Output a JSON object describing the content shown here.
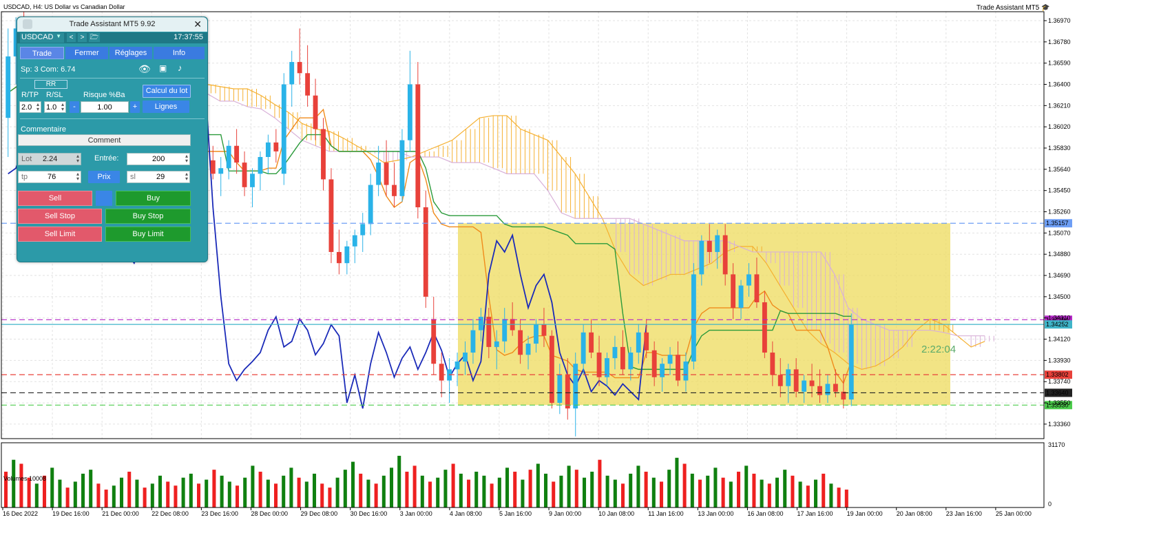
{
  "chart": {
    "header": "USDCAD, H4:  US Dollar vs Canadian Dollar",
    "watermark": "Trade Assistant MT5",
    "volume_label": "Volumes 10008",
    "countdown": "2:22:04",
    "colors": {
      "bull": "#2ab3e8",
      "bear": "#e8413a",
      "kijun": "#2a9a3a",
      "tenkan": "#f08a1a",
      "chikou": "#1a2ab8",
      "kumo_up": "#f5b030",
      "kumo_down": "#d8b0d8",
      "zone": "#eedb5c",
      "vol_up": "#108010",
      "vol_down": "#ee2020"
    }
  },
  "chart_data": {
    "type": "candlestick",
    "symbol": "USDCAD",
    "timeframe": "H4",
    "ylim": [
      1.3323,
      1.3705
    ],
    "y_ticks": [
      "1.36970",
      "1.36780",
      "1.36590",
      "1.36400",
      "1.36210",
      "1.36020",
      "1.35830",
      "1.35640",
      "1.35450",
      "1.35260",
      "1.35070",
      "1.34880",
      "1.34690",
      "1.34500",
      "1.34310",
      "1.34120",
      "1.33930",
      "1.33740",
      "1.33550",
      "1.33360"
    ],
    "x_ticks": [
      "16 Dec 2022",
      "19 Dec 16:00",
      "21 Dec 00:00",
      "22 Dec 08:00",
      "23 Dec 16:00",
      "28 Dec 00:00",
      "29 Dec 08:00",
      "30 Dec 16:00",
      "3 Jan 00:00",
      "4 Jan 08:00",
      "5 Jan 16:00",
      "9 Jan 00:00",
      "10 Jan 08:00",
      "11 Jan 16:00",
      "13 Jan 00:00",
      "16 Jan 08:00",
      "17 Jan 16:00",
      "19 Jan 00:00",
      "20 Jan 08:00",
      "23 Jan 16:00",
      "25 Jan 00:00"
    ],
    "price_levels": [
      {
        "label": "1.35157",
        "value": 1.35157,
        "color": "#6d9ef5"
      },
      {
        "label": "1.34294",
        "value": 1.34294,
        "color": "#b427c8"
      },
      {
        "label": "1.34252",
        "value": 1.34252,
        "color": "#3fb4c8"
      },
      {
        "label": "1.33802",
        "value": 1.33802,
        "color": "#e8413a"
      },
      {
        "label": "1.33640",
        "value": 1.3364,
        "color": "#222222"
      },
      {
        "label": "1.33530",
        "value": 1.3353,
        "color": "#4ccc4c"
      }
    ],
    "volume_axis": [
      "31170",
      "0"
    ],
    "candles": [
      [
        1.361,
        1.369,
        1.3575,
        1.3665
      ],
      [
        1.3665,
        1.37,
        1.364,
        1.369
      ],
      [
        1.369,
        1.3705,
        1.3655,
        1.3668
      ],
      [
        1.3585,
        1.36,
        1.353,
        1.3545
      ],
      [
        1.3545,
        1.3575,
        1.352,
        1.356
      ],
      [
        1.356,
        1.359,
        1.3545,
        1.358
      ],
      [
        1.358,
        1.363,
        1.357,
        1.3615
      ],
      [
        1.3615,
        1.364,
        1.3595,
        1.3605
      ],
      [
        1.3605,
        1.3615,
        1.356,
        1.357
      ],
      [
        1.357,
        1.36,
        1.356,
        1.359
      ],
      [
        1.359,
        1.361,
        1.3575,
        1.358
      ],
      [
        1.352,
        1.354,
        1.349,
        1.35
      ],
      [
        1.35,
        1.3535,
        1.3485,
        1.3525
      ],
      [
        1.3525,
        1.358,
        1.3515,
        1.357
      ],
      [
        1.357,
        1.3585,
        1.353,
        1.354
      ],
      [
        1.354,
        1.3555,
        1.35,
        1.351
      ],
      [
        1.351,
        1.3545,
        1.35,
        1.3535
      ],
      [
        1.3535,
        1.36,
        1.353,
        1.359
      ],
      [
        1.359,
        1.361,
        1.3575,
        1.36
      ],
      [
        1.36,
        1.363,
        1.359,
        1.3622
      ],
      [
        1.3622,
        1.3635,
        1.3595,
        1.3605
      ],
      [
        1.3605,
        1.3615,
        1.358,
        1.3585
      ],
      [
        1.3585,
        1.36,
        1.356,
        1.357
      ],
      [
        1.357,
        1.358,
        1.3535,
        1.3545
      ],
      [
        1.3545,
        1.3565,
        1.3525,
        1.3555
      ],
      [
        1.3555,
        1.358,
        1.3545,
        1.3572
      ],
      [
        1.3572,
        1.3585,
        1.3555,
        1.356
      ],
      [
        1.356,
        1.3575,
        1.354,
        1.3565
      ],
      [
        1.3565,
        1.359,
        1.3555,
        1.3585
      ],
      [
        1.3585,
        1.36,
        1.356,
        1.357
      ],
      [
        1.357,
        1.358,
        1.354,
        1.3548
      ],
      [
        1.3548,
        1.3565,
        1.353,
        1.356
      ],
      [
        1.356,
        1.358,
        1.3545,
        1.3575
      ],
      [
        1.3575,
        1.3595,
        1.356,
        1.3588
      ],
      [
        1.3588,
        1.36,
        1.357,
        1.358
      ],
      [
        1.356,
        1.365,
        1.355,
        1.364
      ],
      [
        1.364,
        1.367,
        1.362,
        1.366
      ],
      [
        1.366,
        1.369,
        1.364,
        1.365
      ],
      [
        1.365,
        1.3675,
        1.362,
        1.363
      ],
      [
        1.363,
        1.3645,
        1.359,
        1.36
      ],
      [
        1.36,
        1.361,
        1.3545,
        1.3555
      ],
      [
        1.3555,
        1.3565,
        1.348,
        1.349
      ],
      [
        1.349,
        1.351,
        1.347,
        1.348
      ],
      [
        1.348,
        1.35,
        1.347,
        1.3495
      ],
      [
        1.3495,
        1.351,
        1.348,
        1.3505
      ],
      [
        1.3505,
        1.3525,
        1.349,
        1.3515
      ],
      [
        1.3515,
        1.356,
        1.3505,
        1.355
      ],
      [
        1.355,
        1.3585,
        1.354,
        1.357
      ],
      [
        1.357,
        1.359,
        1.354,
        1.355
      ],
      [
        1.355,
        1.357,
        1.353,
        1.354
      ],
      [
        1.354,
        1.36,
        1.3535,
        1.359
      ],
      [
        1.359,
        1.367,
        1.358,
        1.364
      ],
      [
        1.364,
        1.366,
        1.352,
        1.353
      ],
      [
        1.353,
        1.3545,
        1.344,
        1.345
      ],
      [
        1.343,
        1.345,
        1.338,
        1.339
      ],
      [
        1.339,
        1.34,
        1.336,
        1.3375
      ],
      [
        1.3375,
        1.3395,
        1.3355,
        1.3385
      ],
      [
        1.3385,
        1.34,
        1.337,
        1.3392
      ],
      [
        1.3392,
        1.341,
        1.338,
        1.34
      ],
      [
        1.34,
        1.343,
        1.339,
        1.342
      ],
      [
        1.342,
        1.344,
        1.341,
        1.3432
      ],
      [
        1.3432,
        1.344,
        1.3395,
        1.3405
      ],
      [
        1.3405,
        1.342,
        1.3385,
        1.341
      ],
      [
        1.341,
        1.344,
        1.34,
        1.343
      ],
      [
        1.343,
        1.3445,
        1.3415,
        1.342
      ],
      [
        1.342,
        1.343,
        1.339,
        1.3398
      ],
      [
        1.3398,
        1.3415,
        1.3385,
        1.3408
      ],
      [
        1.3408,
        1.343,
        1.34,
        1.3425
      ],
      [
        1.3425,
        1.344,
        1.3405,
        1.3415
      ],
      [
        1.3415,
        1.342,
        1.335,
        1.3355
      ],
      [
        1.3355,
        1.339,
        1.3345,
        1.338
      ],
      [
        1.338,
        1.3395,
        1.334,
        1.335
      ],
      [
        1.335,
        1.34,
        1.3325,
        1.339
      ],
      [
        1.339,
        1.3425,
        1.338,
        1.3418
      ],
      [
        1.3418,
        1.343,
        1.3395,
        1.34
      ],
      [
        1.34,
        1.3415,
        1.337,
        1.3378
      ],
      [
        1.3378,
        1.34,
        1.337,
        1.3395
      ],
      [
        1.3395,
        1.3415,
        1.3385,
        1.3405
      ],
      [
        1.3405,
        1.342,
        1.338,
        1.3385
      ],
      [
        1.3385,
        1.3405,
        1.3375,
        1.34
      ],
      [
        1.34,
        1.3425,
        1.339,
        1.3418
      ],
      [
        1.3418,
        1.343,
        1.3395,
        1.3402
      ],
      [
        1.3402,
        1.341,
        1.337,
        1.3378
      ],
      [
        1.3378,
        1.3395,
        1.3365,
        1.339
      ],
      [
        1.339,
        1.3405,
        1.338,
        1.3398
      ],
      [
        1.3398,
        1.341,
        1.337,
        1.3375
      ],
      [
        1.3375,
        1.34,
        1.3365,
        1.3392
      ],
      [
        1.3392,
        1.348,
        1.3385,
        1.347
      ],
      [
        1.347,
        1.3505,
        1.346,
        1.35
      ],
      [
        1.35,
        1.3515,
        1.348,
        1.349
      ],
      [
        1.349,
        1.351,
        1.3475,
        1.3505
      ],
      [
        1.3505,
        1.3515,
        1.346,
        1.347
      ],
      [
        1.347,
        1.348,
        1.343,
        1.344
      ],
      [
        1.344,
        1.3465,
        1.343,
        1.346
      ],
      [
        1.346,
        1.348,
        1.345,
        1.347
      ],
      [
        1.347,
        1.3485,
        1.344,
        1.3445
      ],
      [
        1.3445,
        1.3455,
        1.3395,
        1.34
      ],
      [
        1.34,
        1.341,
        1.337,
        1.338
      ],
      [
        1.338,
        1.3395,
        1.336,
        1.337
      ],
      [
        1.337,
        1.339,
        1.3355,
        1.3385
      ],
      [
        1.3385,
        1.3395,
        1.336,
        1.3365
      ],
      [
        1.3365,
        1.338,
        1.3355,
        1.3375
      ],
      [
        1.3375,
        1.339,
        1.336,
        1.337
      ],
      [
        1.337,
        1.3385,
        1.3355,
        1.3362
      ],
      [
        1.3362,
        1.338,
        1.3355,
        1.3372
      ],
      [
        1.3372,
        1.3385,
        1.336,
        1.3365
      ],
      [
        1.3365,
        1.338,
        1.335,
        1.3358
      ],
      [
        1.3358,
        1.3435,
        1.3352,
        1.3425
      ]
    ],
    "volumes": [
      [
        18000,
        0
      ],
      [
        24000,
        1
      ],
      [
        22000,
        0
      ],
      [
        15000,
        0
      ],
      [
        12000,
        1
      ],
      [
        16000,
        0
      ],
      [
        20000,
        1
      ],
      [
        14000,
        1
      ],
      [
        10000,
        0
      ],
      [
        13000,
        1
      ],
      [
        17000,
        1
      ],
      [
        19000,
        1
      ],
      [
        12000,
        0
      ],
      [
        9000,
        0
      ],
      [
        11000,
        1
      ],
      [
        15000,
        1
      ],
      [
        18000,
        0
      ],
      [
        14000,
        1
      ],
      [
        10000,
        0
      ],
      [
        12000,
        1
      ],
      [
        16000,
        1
      ],
      [
        13000,
        0
      ],
      [
        11000,
        0
      ],
      [
        15000,
        1
      ],
      [
        17000,
        1
      ],
      [
        12000,
        0
      ],
      [
        14000,
        1
      ],
      [
        19000,
        0
      ],
      [
        16000,
        1
      ],
      [
        13000,
        1
      ],
      [
        11000,
        0
      ],
      [
        15000,
        1
      ],
      [
        21000,
        1
      ],
      [
        18000,
        0
      ],
      [
        14000,
        1
      ],
      [
        12000,
        0
      ],
      [
        16000,
        1
      ],
      [
        20000,
        1
      ],
      [
        15000,
        0
      ],
      [
        13000,
        1
      ],
      [
        17000,
        1
      ],
      [
        12000,
        0
      ],
      [
        10000,
        0
      ],
      [
        15000,
        1
      ],
      [
        19000,
        1
      ],
      [
        23000,
        1
      ],
      [
        17000,
        0
      ],
      [
        14000,
        1
      ],
      [
        12000,
        0
      ],
      [
        16000,
        1
      ],
      [
        20000,
        1
      ],
      [
        26000,
        1
      ],
      [
        18000,
        0
      ],
      [
        21000,
        0
      ],
      [
        16000,
        1
      ],
      [
        13000,
        0
      ],
      [
        15000,
        1
      ],
      [
        19000,
        1
      ],
      [
        22000,
        0
      ],
      [
        17000,
        1
      ],
      [
        14000,
        0
      ],
      [
        18000,
        1
      ],
      [
        16000,
        1
      ],
      [
        12000,
        0
      ],
      [
        15000,
        1
      ],
      [
        20000,
        1
      ],
      [
        18000,
        0
      ],
      [
        14000,
        1
      ],
      [
        19000,
        0
      ],
      [
        22000,
        1
      ],
      [
        17000,
        1
      ],
      [
        13000,
        0
      ],
      [
        16000,
        1
      ],
      [
        21000,
        1
      ],
      [
        19000,
        0
      ],
      [
        15000,
        1
      ],
      [
        18000,
        1
      ],
      [
        24000,
        0
      ],
      [
        16000,
        1
      ],
      [
        14000,
        1
      ],
      [
        12000,
        0
      ],
      [
        17000,
        1
      ],
      [
        21000,
        1
      ],
      [
        18000,
        0
      ],
      [
        15000,
        1
      ],
      [
        13000,
        0
      ],
      [
        19000,
        1
      ],
      [
        25000,
        1
      ],
      [
        22000,
        0
      ],
      [
        17000,
        1
      ],
      [
        14000,
        0
      ],
      [
        16000,
        1
      ],
      [
        20000,
        1
      ],
      [
        15000,
        0
      ],
      [
        13000,
        1
      ],
      [
        18000,
        0
      ],
      [
        21000,
        1
      ],
      [
        17000,
        0
      ],
      [
        14000,
        1
      ],
      [
        12000,
        0
      ],
      [
        15000,
        1
      ],
      [
        19000,
        1
      ],
      [
        16000,
        0
      ],
      [
        13000,
        1
      ],
      [
        11000,
        0
      ],
      [
        14000,
        1
      ],
      [
        17000,
        0
      ],
      [
        12000,
        1
      ],
      [
        10000,
        0
      ],
      [
        9000,
        0
      ]
    ]
  },
  "panel": {
    "title": "Trade Assistant MT5 9.92",
    "symbol": "USDCAD",
    "nav_prev": "<",
    "nav_next": ">",
    "clock": "17:37:55",
    "tabs": [
      "Trade",
      "Fermer",
      "Réglages",
      "Info"
    ],
    "spread": "Sp: 3  Com: 6.74",
    "rr_label": "RR",
    "rtp_label": "R/TP",
    "rsl_label": "R/SL",
    "risk_label": "Risque %Ba",
    "calc_btn": "Calcul du lot",
    "rtp_value": "2.0",
    "rsl_value": "1.0",
    "risk_value": "1.00",
    "minus": "-",
    "plus": "+",
    "lines_btn": "Lignes",
    "comment_label": "Commentaire",
    "comment_value": "Comment",
    "lot_label": "Lot",
    "lot_value": "2.24",
    "entry_label": "Entrée:",
    "entry_value": "200",
    "tp_label": "tp",
    "tp_value": "76",
    "price_btn": "Prix",
    "sl_label": "sl",
    "sl_value": "29",
    "sell": "Sell",
    "buy": "Buy",
    "sell_stop": "Sell Stop",
    "buy_stop": "Buy Stop",
    "sell_limit": "Sell Limit",
    "buy_limit": "Buy Limit"
  }
}
